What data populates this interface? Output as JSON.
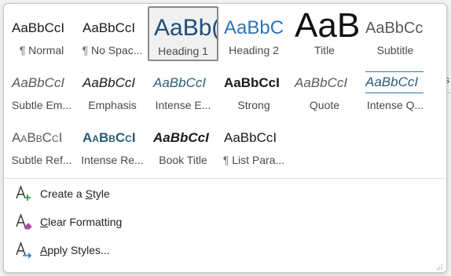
{
  "gallery": {
    "tiles": [
      {
        "sample": "AaBbCcI",
        "label": "Normal",
        "para_mark": "¶",
        "style": "normal",
        "selected": false
      },
      {
        "sample": "AaBbCcI",
        "label": "No Spac...",
        "para_mark": "¶",
        "style": "nospacing",
        "selected": false
      },
      {
        "sample": "AaBb(",
        "label": "Heading 1",
        "para_mark": "",
        "style": "h1",
        "selected": true
      },
      {
        "sample": "AaBbC",
        "label": "Heading 2",
        "para_mark": "",
        "style": "h2",
        "selected": false
      },
      {
        "sample": "AaB",
        "label": "Title",
        "para_mark": "",
        "style": "title",
        "selected": false
      },
      {
        "sample": "AaBbCc",
        "label": "Subtitle",
        "para_mark": "",
        "style": "subtitle",
        "selected": false
      },
      {
        "sample": "AaBbCcI",
        "label": "Subtle Em...",
        "para_mark": "",
        "style": "subtleem",
        "selected": false
      },
      {
        "sample": "AaBbCcI",
        "label": "Emphasis",
        "para_mark": "",
        "style": "emphasis",
        "selected": false
      },
      {
        "sample": "AaBbCcI",
        "label": "Intense E...",
        "para_mark": "",
        "style": "intensee",
        "selected": false
      },
      {
        "sample": "AaBbCcI",
        "label": "Strong",
        "para_mark": "",
        "style": "strong",
        "selected": false
      },
      {
        "sample": "AaBbCcI",
        "label": "Quote",
        "para_mark": "",
        "style": "quote",
        "selected": false
      },
      {
        "sample": "AaBbCcI",
        "label": "Intense Q...",
        "para_mark": "",
        "style": "intenseq",
        "selected": false
      },
      {
        "sample": "AaBbCcI",
        "label": "Subtle Ref...",
        "para_mark": "",
        "style": "subtleref",
        "selected": false
      },
      {
        "sample": "AaBbCcI",
        "label": "Intense Re...",
        "para_mark": "",
        "style": "intenseref",
        "selected": false
      },
      {
        "sample": "AaBbCcI",
        "label": "Book Title",
        "para_mark": "",
        "style": "booktitle",
        "selected": false
      },
      {
        "sample": "AaBbCcI",
        "label": "List Para...",
        "para_mark": "¶",
        "style": "listpara",
        "selected": false
      }
    ]
  },
  "commands": [
    {
      "name": "create-style",
      "before": "Create a ",
      "key": "S",
      "after": "tyle",
      "icon": "create-style-icon"
    },
    {
      "name": "clear-formatting",
      "before": "",
      "key": "C",
      "after": "lear Formatting",
      "icon": "clear-formatting-icon"
    },
    {
      "name": "apply-styles",
      "before": "",
      "key": "A",
      "after": "pply Styles...",
      "icon": "apply-styles-icon"
    }
  ],
  "colors": {
    "heading_blue": "#1f4e79",
    "accent_blue": "#2e74b5",
    "intense_teal": "#2a5d78",
    "grey_text": "#595959",
    "icon_green": "#3a9a48",
    "icon_purple": "#a64ca6",
    "icon_blue": "#2b7bc0"
  }
}
